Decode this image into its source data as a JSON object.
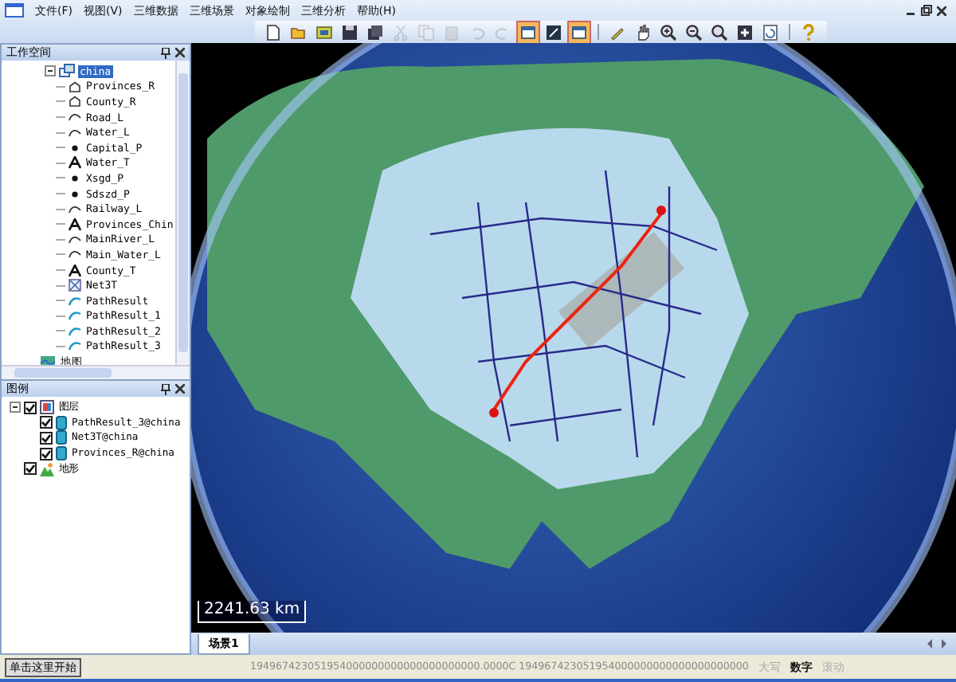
{
  "menu_bar": {
    "items": [
      "文件(F)",
      "视图(V)",
      "三维数据",
      "三维场景",
      "对象绘制",
      "三维分析",
      "帮助(H)"
    ]
  },
  "toolbar": [
    {
      "kind": "new",
      "disabled": false,
      "selected": false
    },
    {
      "kind": "open",
      "disabled": false,
      "selected": false
    },
    {
      "kind": "layers",
      "disabled": false,
      "selected": false
    },
    {
      "kind": "save",
      "disabled": false,
      "selected": false
    },
    {
      "kind": "saveall",
      "disabled": false,
      "selected": false
    },
    {
      "kind": "cut",
      "disabled": true,
      "selected": false
    },
    {
      "kind": "copy",
      "disabled": true,
      "selected": false
    },
    {
      "kind": "paste",
      "disabled": true,
      "selected": false
    },
    {
      "kind": "undo",
      "disabled": true,
      "selected": false
    },
    {
      "kind": "redo",
      "disabled": true,
      "selected": false
    },
    {
      "kind": "panel",
      "disabled": false,
      "selected": true
    },
    {
      "kind": "view",
      "disabled": false,
      "selected": false
    },
    {
      "kind": "panel",
      "disabled": false,
      "selected": true
    },
    {
      "kind": "pen",
      "disabled": false,
      "selected": false
    },
    {
      "kind": "pan",
      "disabled": false,
      "selected": false
    },
    {
      "kind": "zoomin",
      "disabled": false,
      "selected": false
    },
    {
      "kind": "zoomout",
      "disabled": false,
      "selected": false
    },
    {
      "kind": "zoomfree",
      "disabled": false,
      "selected": false
    },
    {
      "kind": "full",
      "disabled": false,
      "selected": false
    },
    {
      "kind": "refresh",
      "disabled": false,
      "selected": false
    },
    {
      "kind": "help",
      "disabled": false,
      "selected": false
    }
  ],
  "workspace": {
    "title": "工作空间",
    "root": {
      "label": "china",
      "selected": true,
      "expanded": true,
      "children": [
        {
          "kind": "region",
          "label": "Provinces_R"
        },
        {
          "kind": "region",
          "label": "County_R"
        },
        {
          "kind": "line",
          "label": "Road_L"
        },
        {
          "kind": "line",
          "label": "Water_L"
        },
        {
          "kind": "point",
          "label": "Capital_P"
        },
        {
          "kind": "text",
          "label": "Water_T"
        },
        {
          "kind": "point",
          "label": "Xsgd_P"
        },
        {
          "kind": "point",
          "label": "Sdszd_P"
        },
        {
          "kind": "line",
          "label": "Railway_L"
        },
        {
          "kind": "text",
          "label": "Provinces_Chin"
        },
        {
          "kind": "line",
          "label": "MainRiver_L"
        },
        {
          "kind": "line",
          "label": "Main_Water_L"
        },
        {
          "kind": "text",
          "label": "County_T"
        },
        {
          "kind": "network",
          "label": "Net3T"
        },
        {
          "kind": "path",
          "label": "PathResult"
        },
        {
          "kind": "path",
          "label": "PathResult_1"
        },
        {
          "kind": "path",
          "label": "PathResult_2"
        },
        {
          "kind": "path",
          "label": "PathResult_3"
        }
      ]
    },
    "maps": [
      {
        "label": "地图"
      }
    ]
  },
  "legend": {
    "title": "图例",
    "items": [
      {
        "kind": "group",
        "label": "图层",
        "checked": true,
        "expanded": true,
        "children": [
          {
            "kind": "layer",
            "label": "PathResult_3@china",
            "checked": true
          },
          {
            "kind": "layer",
            "label": "Net3T@china",
            "checked": true
          },
          {
            "kind": "layer",
            "label": "Provinces_R@china",
            "checked": true
          }
        ]
      },
      {
        "kind": "terrain",
        "label": "地形",
        "checked": true
      }
    ]
  },
  "scene": {
    "scale_label": "2241.63 km",
    "tabs": [
      {
        "label": "场景1",
        "selected": true
      }
    ]
  },
  "status_bar": {
    "start_button": "单击这里开始",
    "coordinates": "194967423051954000000000000000000000.0000C 194967423051954000000000000000000000",
    "indicators": [
      {
        "label": "大写",
        "disabled": true
      },
      {
        "label": "数字",
        "disabled": false
      },
      {
        "label": "滚动",
        "disabled": true
      }
    ]
  }
}
